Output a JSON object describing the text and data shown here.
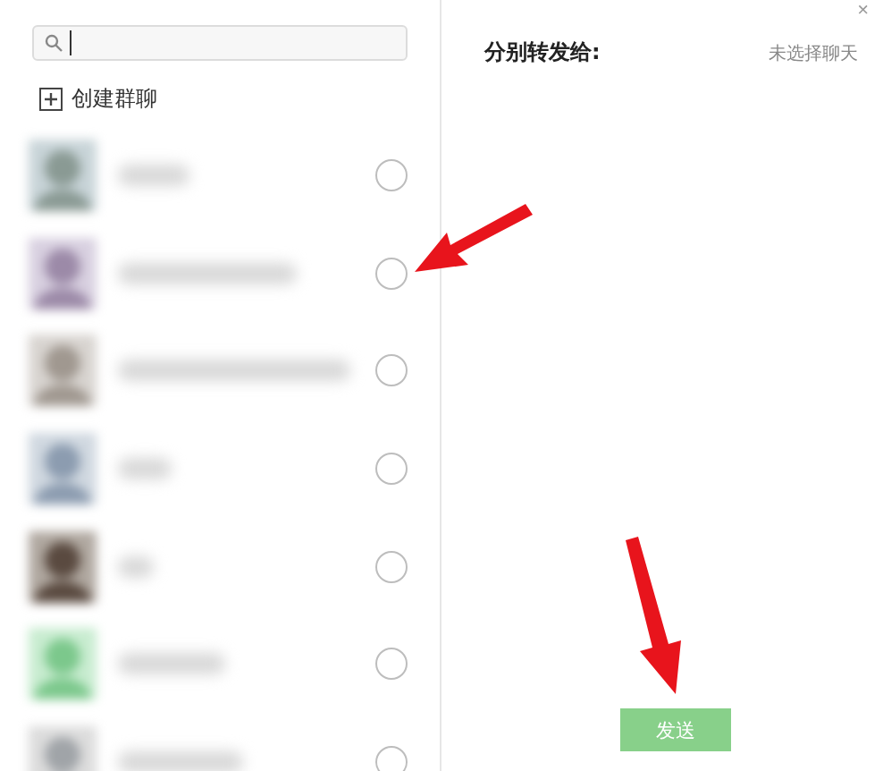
{
  "create_group": {
    "label": "创建群聊"
  },
  "contacts": [
    {
      "selected": false
    },
    {
      "selected": false
    },
    {
      "selected": false
    },
    {
      "selected": false
    },
    {
      "selected": false
    },
    {
      "selected": false
    },
    {
      "selected": false
    }
  ],
  "forward_panel": {
    "title": "分别转发给:",
    "status": "未选择聊天",
    "close": "×"
  },
  "send_button": {
    "label": "发送",
    "disabled": true
  }
}
